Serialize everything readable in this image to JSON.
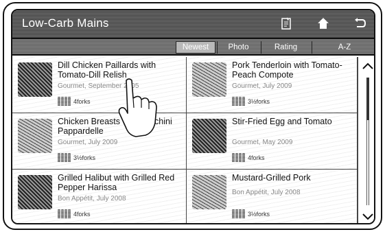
{
  "header": {
    "title": "Low-Carb Mains",
    "icons": [
      "notepad-icon",
      "home-icon",
      "back-icon"
    ]
  },
  "tabs": [
    {
      "label": "Newest",
      "active": true
    },
    {
      "label": "Photo",
      "active": false
    },
    {
      "label": "Rating",
      "active": false
    },
    {
      "label": "A-Z",
      "active": false
    }
  ],
  "recipes": [
    {
      "title": "Dill Chicken Paillards with Tomato-Dill Relish",
      "source": "Gourmet, September 2005",
      "forks": "4forks"
    },
    {
      "title": "Pork Tenderloin with Tomato-Peach Compote",
      "source": "Gourmet, July 2009",
      "forks": "3½forks"
    },
    {
      "title": "Chicken Breasts with Zucchini Pappardelle",
      "source": "Gourmet, July 2009",
      "forks": "3½forks"
    },
    {
      "title": "Stir-Fried Egg and Tomato",
      "source": "Gourmet, May 2009",
      "forks": "4forks"
    },
    {
      "title": "Grilled Halibut with Grilled Red Pepper Harissa",
      "source": "Bon Appétit, July 2008",
      "forks": "4forks"
    },
    {
      "title": "Mustard-Grilled Pork",
      "source": "Bon Appétit, July 2008",
      "forks": "3½forks"
    }
  ]
}
